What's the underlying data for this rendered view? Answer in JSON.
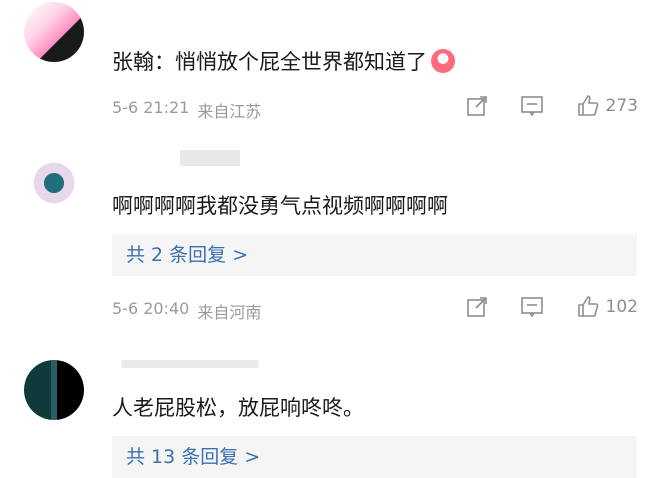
{
  "comments": [
    {
      "avatar": "avatar-pink",
      "username": "",
      "text": "张翰：悄悄放个屁全世界都知道了",
      "emoji": "laughing-crying-emoji",
      "date": "5-6 21:21",
      "location": "来自江苏",
      "likes": "273"
    },
    {
      "avatar": "avatar-teal",
      "username": "",
      "text": "啊啊啊啊我都没勇气点视频啊啊啊啊",
      "replies": "共 2 条回复 >",
      "date": "5-6 20:40",
      "location": "来自河南",
      "likes": "102"
    },
    {
      "avatar": "avatar-dark",
      "username": "",
      "text": "人老屁股松，放屁响咚咚。",
      "replies": "共 13 条回复 >"
    }
  ],
  "icons": {
    "share": "share-icon",
    "comment": "comment-icon",
    "like": "thumbs-up-icon"
  }
}
